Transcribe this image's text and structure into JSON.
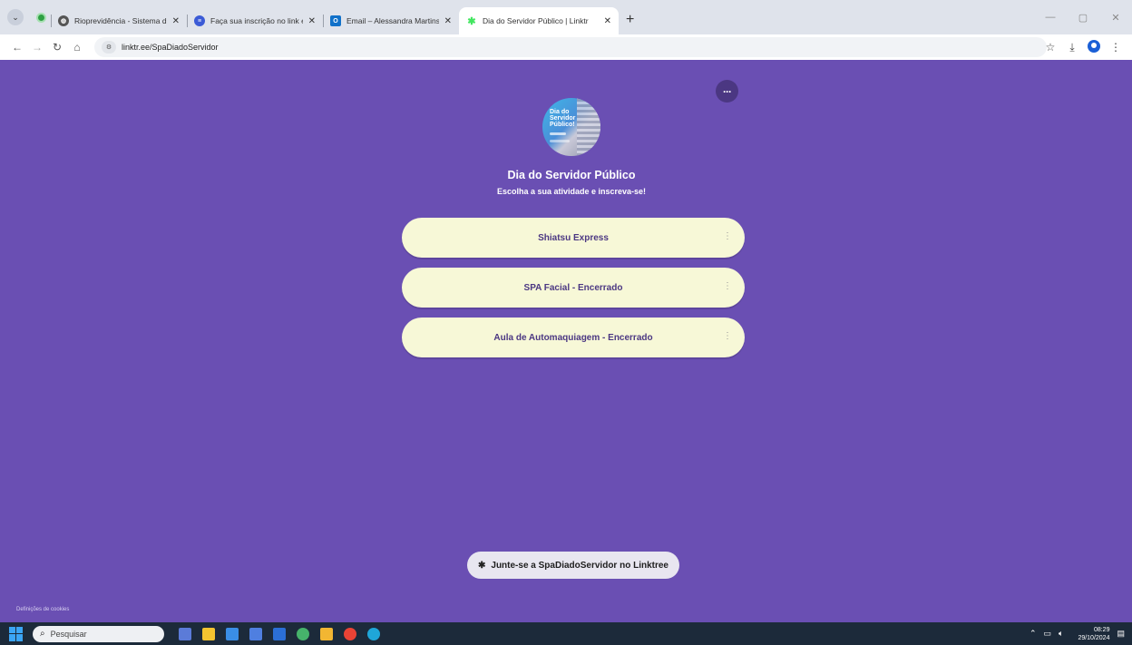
{
  "browser": {
    "tabs": [
      {
        "title": "Rioprevidência - Sistema de Po",
        "favicon": "globe-icon",
        "active": false
      },
      {
        "title": "Faça sua inscrição no link envia",
        "favicon": "forms-icon",
        "active": false
      },
      {
        "title": "Email – Alessandra Martins Silva",
        "favicon": "outlook-icon",
        "active": false
      },
      {
        "title": "Dia do Servidor Público | Linktr",
        "favicon": "linktree-icon",
        "active": true
      }
    ],
    "url": "linktr.ee/SpaDiadoServidor"
  },
  "profile": {
    "title": "Dia do Servidor Público",
    "subtitle": "Escolha a sua atividade e inscreva-se!",
    "avatar_text": "Dia do Servidor Público!"
  },
  "links": [
    {
      "label": "Shiatsu Express"
    },
    {
      "label": "SPA Facial - Encerrado"
    },
    {
      "label": "Aula de Automaquiagem - Encerrado"
    }
  ],
  "footer": {
    "join_label": "Junte-se a SpaDiadoServidor no Linktree",
    "cookies_label": "Definições de cookies"
  },
  "taskbar": {
    "search_placeholder": "Pesquisar",
    "time": "08:29",
    "date": "29/10/2024"
  },
  "colors": {
    "page_background": "#6a4fb3",
    "link_button": "#f7f8d7",
    "link_text": "#4b3782"
  }
}
